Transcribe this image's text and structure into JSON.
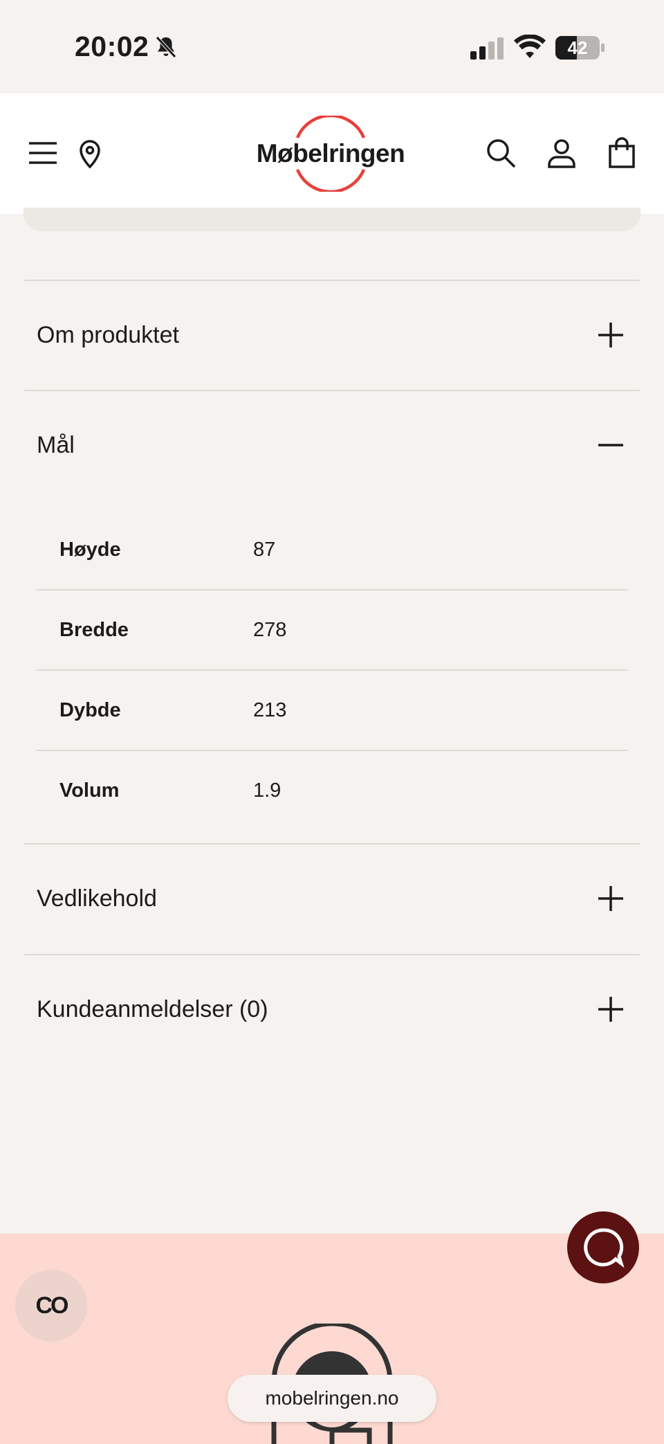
{
  "status_bar": {
    "time": "20:02",
    "battery": "42"
  },
  "header": {
    "logo": "Møbelringen"
  },
  "accordions": [
    {
      "label": "Om produktet",
      "state": "+"
    },
    {
      "label": "Mål",
      "state": "−"
    },
    {
      "label": "Vedlikehold",
      "state": "+"
    },
    {
      "label": "Kundeanmeldelser (0)",
      "state": "+"
    }
  ],
  "dimensions": [
    {
      "key": "Høyde",
      "value": "87"
    },
    {
      "key": "Bredde",
      "value": "278"
    },
    {
      "key": "Dybde",
      "value": "213"
    },
    {
      "key": "Volum",
      "value": "1.9"
    }
  ],
  "floating": {
    "co_label": "CO"
  },
  "browser": {
    "url": "mobelringen.no"
  },
  "colors": {
    "accent_red": "#e8403a",
    "chat_button": "#5c1212",
    "footer_bg": "#fdd9d2",
    "page_bg": "#f5f2ef"
  }
}
